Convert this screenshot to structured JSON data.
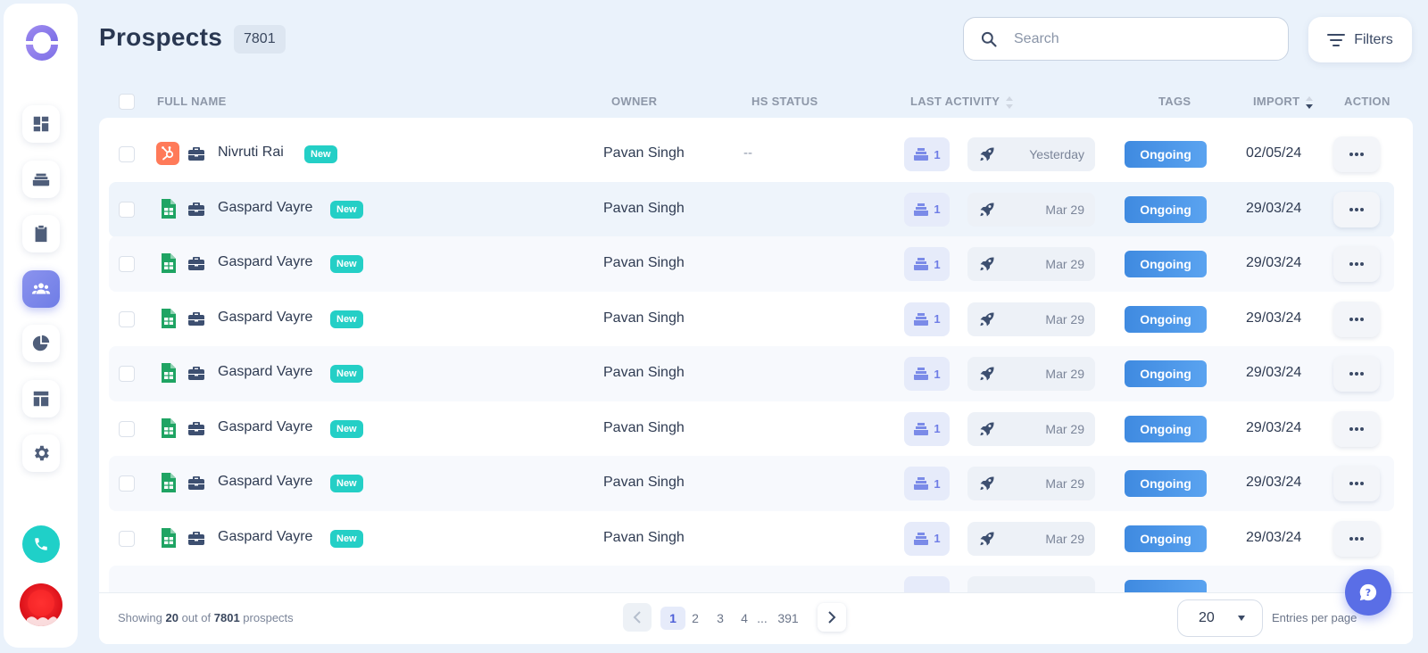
{
  "header": {
    "title": "Prospects",
    "count": "7801",
    "search_placeholder": "Search",
    "filters_label": "Filters"
  },
  "sidebar": {
    "items": [
      {
        "name": "dashboard",
        "icon": "dashboard-icon"
      },
      {
        "name": "inbox",
        "icon": "inbox-stack-icon"
      },
      {
        "name": "tasks",
        "icon": "clipboard-icon"
      },
      {
        "name": "prospects",
        "icon": "people-icon",
        "active": true
      },
      {
        "name": "reports",
        "icon": "pie-chart-icon"
      },
      {
        "name": "templates",
        "icon": "layout-icon"
      },
      {
        "name": "settings",
        "icon": "gear-icon"
      }
    ]
  },
  "table": {
    "columns": {
      "full_name": "FULL NAME",
      "owner": "OWNER",
      "hs_status": "HS STATUS",
      "last_activity": "LAST ACTIVITY",
      "tags": "TAGS",
      "import": "IMPORT",
      "action": "ACTION"
    },
    "rows": [
      {
        "source": "hubspot",
        "name": "Nivruti Rai",
        "badge": "New",
        "owner": "Pavan Singh",
        "hs_status": "--",
        "activity_count": "1",
        "activity_date": "Yesterday",
        "tag": "Ongoing",
        "import": "02/05/24"
      },
      {
        "source": "sheets",
        "name": "Gaspard Vayre",
        "badge": "New",
        "owner": "Pavan Singh",
        "hs_status": "",
        "activity_count": "1",
        "activity_date": "Mar 29",
        "tag": "Ongoing",
        "import": "29/03/24"
      },
      {
        "source": "sheets",
        "name": "Gaspard Vayre",
        "badge": "New",
        "owner": "Pavan Singh",
        "hs_status": "",
        "activity_count": "1",
        "activity_date": "Mar 29",
        "tag": "Ongoing",
        "import": "29/03/24"
      },
      {
        "source": "sheets",
        "name": "Gaspard Vayre",
        "badge": "New",
        "owner": "Pavan Singh",
        "hs_status": "",
        "activity_count": "1",
        "activity_date": "Mar 29",
        "tag": "Ongoing",
        "import": "29/03/24"
      },
      {
        "source": "sheets",
        "name": "Gaspard Vayre",
        "badge": "New",
        "owner": "Pavan Singh",
        "hs_status": "",
        "activity_count": "1",
        "activity_date": "Mar 29",
        "tag": "Ongoing",
        "import": "29/03/24"
      },
      {
        "source": "sheets",
        "name": "Gaspard Vayre",
        "badge": "New",
        "owner": "Pavan Singh",
        "hs_status": "",
        "activity_count": "1",
        "activity_date": "Mar 29",
        "tag": "Ongoing",
        "import": "29/03/24"
      },
      {
        "source": "sheets",
        "name": "Gaspard Vayre",
        "badge": "New",
        "owner": "Pavan Singh",
        "hs_status": "",
        "activity_count": "1",
        "activity_date": "Mar 29",
        "tag": "Ongoing",
        "import": "29/03/24"
      },
      {
        "source": "sheets",
        "name": "Gaspard Vayre",
        "badge": "New",
        "owner": "Pavan Singh",
        "hs_status": "",
        "activity_count": "1",
        "activity_date": "Mar 29",
        "tag": "Ongoing",
        "import": "29/03/24"
      }
    ]
  },
  "footer": {
    "showing_prefix": "Showing",
    "showing_count": "20",
    "showing_mid": "out of",
    "showing_total": "7801",
    "showing_suffix": "prospects",
    "pages": [
      "1",
      "2",
      "3",
      "4"
    ],
    "ellipsis": "...",
    "last_page": "391",
    "current_page": "1",
    "per_page": "20",
    "per_page_label": "Entries per page"
  },
  "colors": {
    "accent": "#6f7de6",
    "tag": "#4a95e8",
    "new_badge": "#24cfc6",
    "phone": "#1fd0c8",
    "hubspot": "#ff7a59",
    "sheets": "#1fa463"
  }
}
